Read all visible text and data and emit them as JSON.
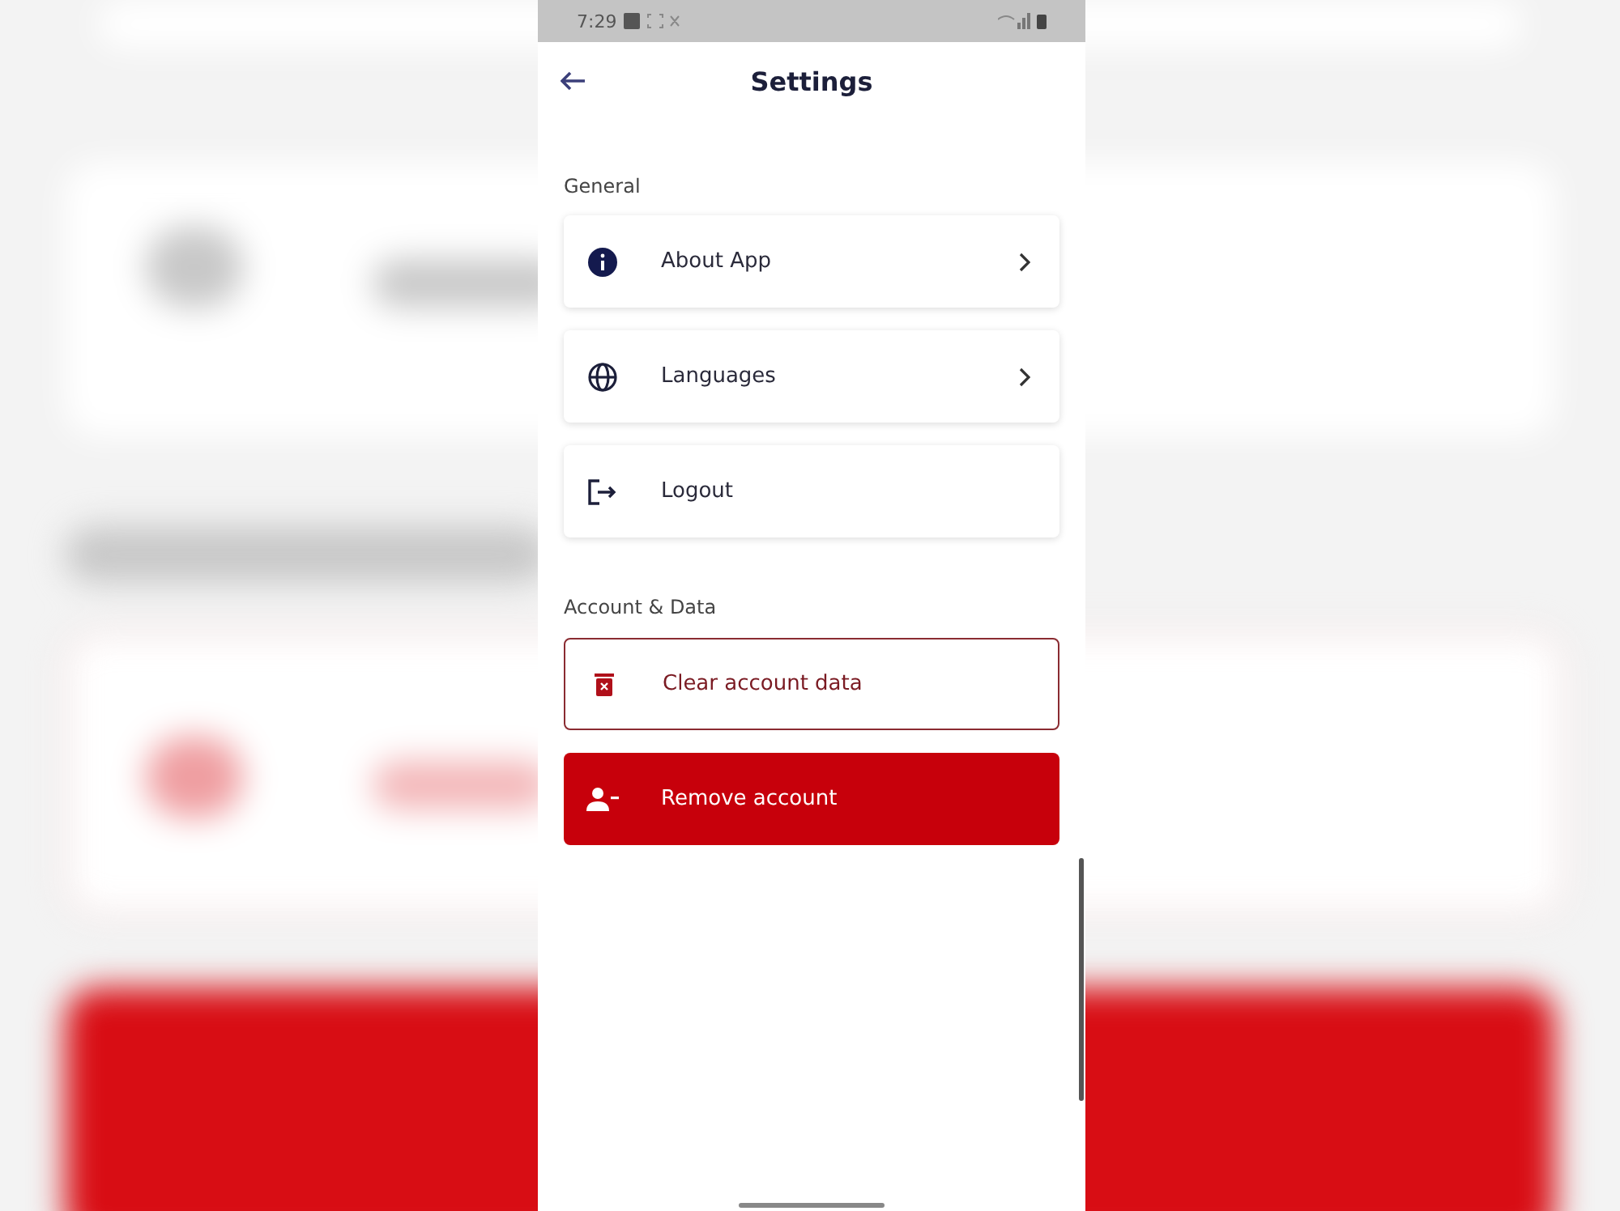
{
  "status_bar": {
    "time": "7:29"
  },
  "header": {
    "title": "Settings"
  },
  "sections": [
    {
      "title": "General",
      "items": [
        {
          "kind": "link",
          "label": "About App"
        },
        {
          "kind": "link",
          "label": "Languages"
        },
        {
          "kind": "action",
          "label": "Logout"
        }
      ]
    },
    {
      "title": "Account & Data",
      "items": [
        {
          "kind": "outline",
          "label": "Clear account data"
        },
        {
          "kind": "filled",
          "label": "Remove account"
        }
      ]
    }
  ]
}
